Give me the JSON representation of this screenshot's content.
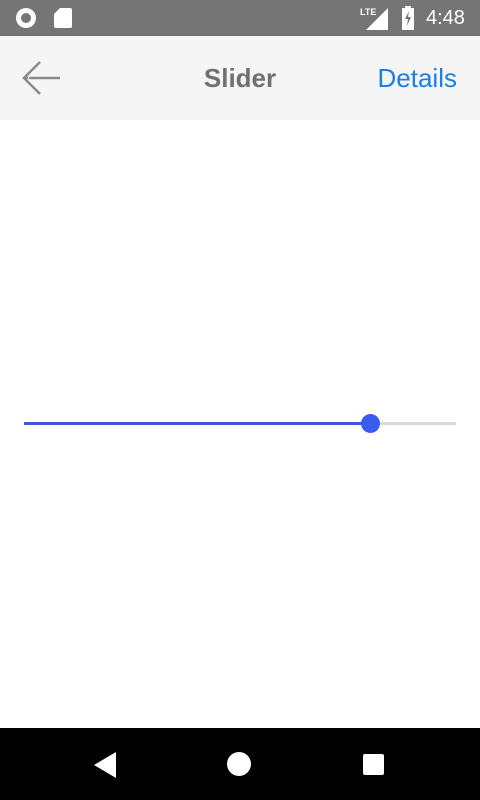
{
  "status_bar": {
    "time": "4:48",
    "network_label": "LTE",
    "icons": [
      "circle-notification-icon",
      "sd-card-icon",
      "lte-signal-icon",
      "battery-charging-icon"
    ]
  },
  "header": {
    "title": "Slider",
    "details_label": "Details",
    "back_icon": "back-arrow-icon"
  },
  "slider": {
    "value": 0.8,
    "min": 0,
    "max": 1,
    "track_color": "#d9d9d9",
    "active_color": "#3b5bf0"
  },
  "nav_bar": {
    "icons": [
      "nav-back-icon",
      "nav-home-icon",
      "nav-recents-icon"
    ]
  }
}
